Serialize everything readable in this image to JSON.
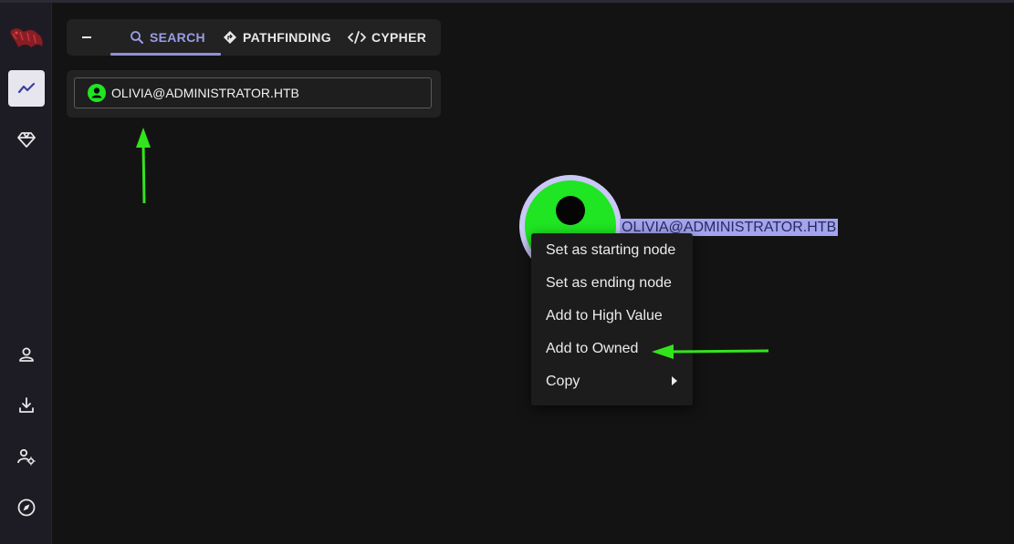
{
  "tabs": [
    {
      "label": "SEARCH",
      "icon": "search-icon"
    },
    {
      "label": "PATHFINDING",
      "icon": "pathfinding-icon"
    },
    {
      "label": "CYPHER",
      "icon": "code-icon"
    }
  ],
  "search": {
    "value": "OLIVIA@ADMINISTRATOR.HTB",
    "icon": "user-icon"
  },
  "graph": {
    "node_label": "OLIVIA@ADMINISTRATOR.HTB"
  },
  "context_menu": {
    "items": [
      "Set as starting node",
      "Set as ending node",
      "Add to High Value",
      "Add to Owned",
      "Copy"
    ]
  },
  "sidebar": {
    "icons": [
      "bloodhound-logo",
      "explore-icon",
      "group-management-icon",
      "profile-icon",
      "download-icon",
      "administration-icon",
      "compass-icon"
    ]
  },
  "colors": {
    "accent": "#8e91dd",
    "node_fill": "#1fe522",
    "annotation_arrow": "#33e31c",
    "background": "#131313"
  }
}
